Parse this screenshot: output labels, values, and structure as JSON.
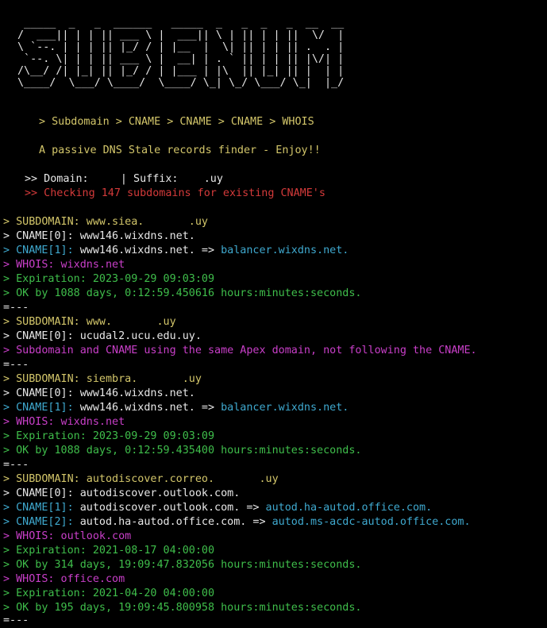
{
  "banner_art": " _____  _   _  ______   _____  _   _  _   _  __  __ \n/  ___|| | | || ___ \\ |  ___|| \\ | || | | ||  \\/  |\n\\ `--. | | | || |_/ / | |__  |  \\| || | | || .  . |\n `--. \\| | | || ___ \\ |  __| | . ` || | | || |\\/| |\n/\\__/ /| |_| || |_/ / | |___ | |\\  || |_| || |  | |\n\\____/  \\___/ \\____/  \\____/ \\_| \\_/ \\___/ \\_|  |_/",
  "header": {
    "flow": "> Subdomain > CNAME > CNAME > CNAME > WHOIS",
    "tagline": "A passive DNS Stale records finder - Enjoy!!",
    "domain_line": ">> Domain:     | Suffix:    .uy",
    "checking_line": ">> Checking 147 subdomains for existing CNAME's"
  },
  "colors": {
    "background": "#000000",
    "yellow": "#d3c66a",
    "white": "#e8e8e8",
    "cyan": "#3fa9cf",
    "magenta": "#c93fc9",
    "green": "#3fbe4b",
    "red": "#d43a3a"
  },
  "output": {
    "b1": {
      "sub": "> SUBDOMAIN: www.siea.       .uy",
      "cname0": "> CNAME[0]: www146.wixdns.net.",
      "cname1_key": "> CNAME[1]:",
      "cname1_val": " www146.wixdns.net. =>",
      "cname1_target": " balancer.wixdns.net.",
      "whois": "> WHOIS: wixdns.net",
      "expiration": "> Expiration: 2023-09-29 09:03:09",
      "ok": "> OK by 1088 days, 0:12:59.450616 hours:minutes:seconds.",
      "sep": "=---"
    },
    "b2": {
      "sub": "> SUBDOMAIN: www.       .uy",
      "cname0": "> CNAME[0]: ucudal2.ucu.edu.uy.",
      "note": "> Subdomain and CNAME using the same Apex domain, not following the CNAME.",
      "sep": "=---"
    },
    "b3": {
      "sub": "> SUBDOMAIN: siembra.       .uy",
      "cname0": "> CNAME[0]: www146.wixdns.net.",
      "cname1_key": "> CNAME[1]:",
      "cname1_val": " www146.wixdns.net. =>",
      "cname1_target": " balancer.wixdns.net.",
      "whois": "> WHOIS: wixdns.net",
      "expiration": "> Expiration: 2023-09-29 09:03:09",
      "ok": "> OK by 1088 days, 0:12:59.435400 hours:minutes:seconds.",
      "sep": "=---"
    },
    "b4": {
      "sub": "> SUBDOMAIN: autodiscover.correo.       .uy",
      "cname0": "> CNAME[0]: autodiscover.outlook.com.",
      "cname1_key": "> CNAME[1]:",
      "cname1_val": " autodiscover.outlook.com. =>",
      "cname1_target": " autod.ha-autod.office.com.",
      "cname2_key": "> CNAME[2]:",
      "cname2_val": " autod.ha-autod.office.com. =>",
      "cname2_target": " autod.ms-acdc-autod.office.com.",
      "whois1": "> WHOIS: outlook.com",
      "expiration1": "> Expiration: 2021-08-17 04:00:00",
      "ok1": "> OK by 314 days, 19:09:47.832056 hours:minutes:seconds.",
      "whois2": "> WHOIS: office.com",
      "expiration2": "> Expiration: 2021-04-20 04:00:00",
      "ok2": "> OK by 195 days, 19:09:45.800958 hours:minutes:seconds.",
      "sep": "=---"
    }
  }
}
